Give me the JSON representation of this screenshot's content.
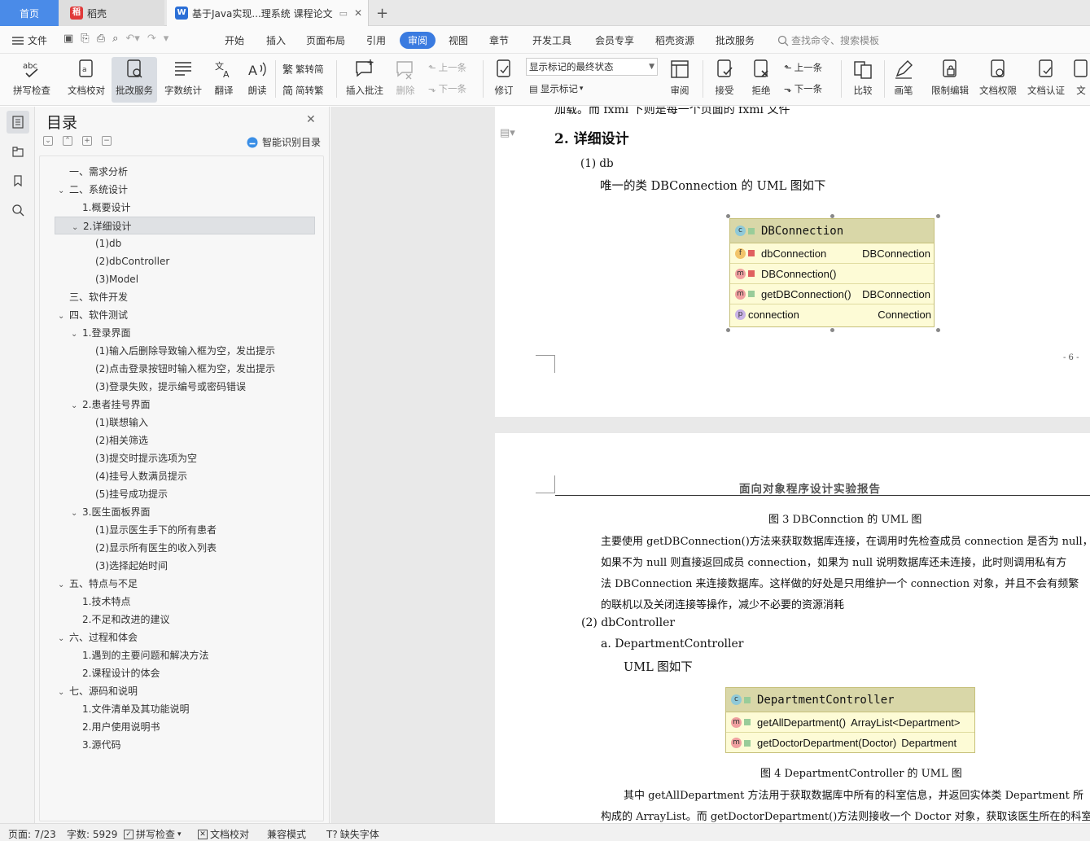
{
  "tabs": {
    "home": "首页",
    "daoke": "稻壳",
    "doc": "基于Java实现...理系统 课程论文",
    "new": "+"
  },
  "menu": {
    "file": "文件",
    "items": [
      "开始",
      "插入",
      "页面布局",
      "引用",
      "审阅",
      "视图",
      "章节",
      "开发工具",
      "会员专享",
      "稻壳资源",
      "批改服务"
    ],
    "active": "审阅",
    "search": "查找命令、搜索模板"
  },
  "ribbon": {
    "spell": "拼写检查",
    "proofread": "文档校对",
    "correct": "批改服务",
    "wordcount": "字数统计",
    "translate": "翻译",
    "read": "朗读",
    "trad": "繁转简",
    "simp": "简转繁",
    "insert_comment": "插入批注",
    "delete": "删除",
    "prev": "上一条",
    "next": "下一条",
    "track": "修订",
    "markup_select": "显示标记的最终状态",
    "show_markup": "显示标记",
    "review": "审阅",
    "accept": "接受",
    "reject": "拒绝",
    "prev2": "上一条",
    "next2": "下一条",
    "compare": "比较",
    "pen": "画笔",
    "restrict": "限制编辑",
    "rights": "文档权限",
    "certify": "文档认证",
    "more": "文"
  },
  "toc": {
    "title": "目录",
    "smart": "智能识别目录",
    "items": [
      {
        "label": "一、需求分析",
        "level": 0,
        "caret": ""
      },
      {
        "label": "二、系统设计",
        "level": 0,
        "caret": "v"
      },
      {
        "label": "1.概要设计",
        "level": 1,
        "caret": ""
      },
      {
        "label": "2.详细设计",
        "level": 1,
        "caret": "v",
        "selected": true
      },
      {
        "label": "(1)db",
        "level": 2,
        "caret": ""
      },
      {
        "label": "(2)dbController",
        "level": 2,
        "caret": ""
      },
      {
        "label": "(3)Model",
        "level": 2,
        "caret": ""
      },
      {
        "label": "三、软件开发",
        "level": 0,
        "caret": ""
      },
      {
        "label": "四、软件测试",
        "level": 0,
        "caret": "v"
      },
      {
        "label": "1.登录界面",
        "level": 1,
        "caret": "v"
      },
      {
        "label": "(1)输入后删除导致输入框为空，发出提示",
        "level": 2,
        "caret": ""
      },
      {
        "label": "(2)点击登录按钮时输入框为空，发出提示",
        "level": 2,
        "caret": ""
      },
      {
        "label": "(3)登录失败，提示编号或密码错误",
        "level": 2,
        "caret": ""
      },
      {
        "label": "2.患者挂号界面",
        "level": 1,
        "caret": "v"
      },
      {
        "label": "(1)联想输入",
        "level": 2,
        "caret": ""
      },
      {
        "label": "(2)相关筛选",
        "level": 2,
        "caret": ""
      },
      {
        "label": "(3)提交时提示选项为空",
        "level": 2,
        "caret": ""
      },
      {
        "label": "(4)挂号人数满员提示",
        "level": 2,
        "caret": ""
      },
      {
        "label": "(5)挂号成功提示",
        "level": 2,
        "caret": ""
      },
      {
        "label": "3.医生面板界面",
        "level": 1,
        "caret": "v"
      },
      {
        "label": "(1)显示医生手下的所有患者",
        "level": 2,
        "caret": ""
      },
      {
        "label": "(2)显示所有医生的收入列表",
        "level": 2,
        "caret": ""
      },
      {
        "label": "(3)选择起始时间",
        "level": 2,
        "caret": ""
      },
      {
        "label": "五、特点与不足",
        "level": 0,
        "caret": "v"
      },
      {
        "label": "1.技术特点",
        "level": 1,
        "caret": ""
      },
      {
        "label": "2.不足和改进的建议",
        "level": 1,
        "caret": ""
      },
      {
        "label": "六、过程和体会",
        "level": 0,
        "caret": "v"
      },
      {
        "label": "1.遇到的主要问题和解决方法",
        "level": 1,
        "caret": ""
      },
      {
        "label": "2.课程设计的体会",
        "level": 1,
        "caret": ""
      },
      {
        "label": "七、源码和说明",
        "level": 0,
        "caret": "v"
      },
      {
        "label": "1.文件清单及其功能说明",
        "level": 1,
        "caret": ""
      },
      {
        "label": "2.用户使用说明书",
        "level": 1,
        "caret": ""
      },
      {
        "label": "3.源代码",
        "level": 1,
        "caret": ""
      }
    ]
  },
  "page1": {
    "top_text": "加载。而 fxml 下则是每一个页面的 fxml 文件",
    "heading": "2. 详细设计",
    "sub1": "(1)  db",
    "line1": "唯一的类 DBConnection 的 UML 图如下",
    "page_no": "- 6 -",
    "uml": {
      "title": "DBConnection",
      "rows": [
        {
          "badge": "f",
          "name": "dbConnection",
          "type": "DBConnection"
        },
        {
          "badge": "m",
          "name": "DBConnection()",
          "type": ""
        },
        {
          "badge": "m",
          "name": "getDBConnection()",
          "type": "DBConnection"
        },
        {
          "badge": "p",
          "name": "connection",
          "type": "Connection"
        }
      ]
    }
  },
  "page2": {
    "header": "面向对象程序设计实验报告",
    "fig3": "图 3 DBConnction 的 UML 图",
    "para1": [
      "主要使用 getDBConnection()方法来获取数据库连接，在调用时先检查成员 connection 是否为 null，",
      "如果不为 null 则直接返回成员 connection，如果为 null 说明数据库还未连接，此时则调用私有方",
      "法 DBConnection 来连接数据库。这样做的好处是只用维护一个 connection 对象，并且不会有频繁",
      "的联机以及关闭连接等操作，减少不必要的资源消耗"
    ],
    "sub2": "(2)  dbController",
    "sub2a": "a.  DepartmentController",
    "uml_line": "UML 图如下",
    "uml2": {
      "title": "DepartmentController",
      "rows": [
        {
          "badge": "m",
          "name": "getAllDepartment()",
          "type": "ArrayList<Department>"
        },
        {
          "badge": "m",
          "name": "getDoctorDepartment(Doctor)",
          "type": "Department"
        }
      ]
    },
    "fig4": "图 4 DepartmentController 的 UML 图",
    "para2": [
      "其中 getAllDepartment 方法用于获取数据库中所有的科室信息，并返回实体类 Department 所",
      "构成的 ArrayList。而 getDoctorDepartment()方法则接收一个 Doctor 对象，获取该医生所在的科室，"
    ]
  },
  "status": {
    "page": "页面: 7/23",
    "words": "字数: 5929",
    "spell": "拼写检查",
    "proof": "文档校对",
    "compat": "兼容模式",
    "missing_font": "缺失字体"
  }
}
